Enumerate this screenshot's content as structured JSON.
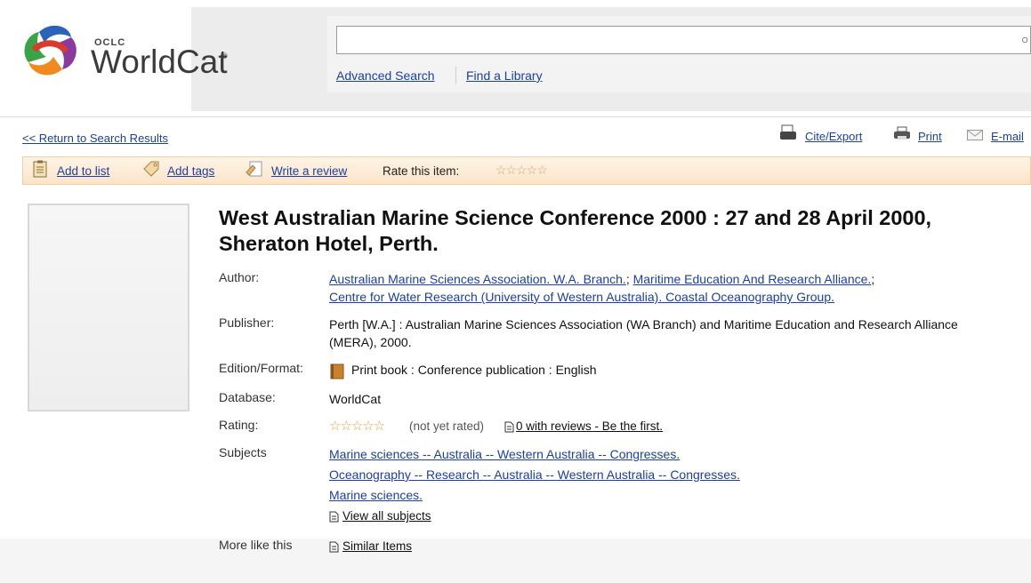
{
  "header": {
    "logo_small": "OCLC",
    "logo_word": "WorldCat",
    "logo_reg": "®",
    "search": {
      "value": "",
      "placeholder": ""
    },
    "advanced_search": "Advanced Search",
    "find_library": "Find a Library"
  },
  "nav": {
    "return": "<< Return to Search Results",
    "cite": "Cite/Export",
    "print": "Print",
    "email": "E-mail"
  },
  "actions": {
    "add_list": "Add to list",
    "add_tags": "Add tags",
    "write_review": "Write a review",
    "rate_label": "Rate this item:",
    "rate_stars": "☆☆☆☆☆"
  },
  "record": {
    "title": "West Australian Marine Science Conference 2000 : 27 and 28 April 2000, Sheraton Hotel, Perth.",
    "author_label": "Author:",
    "authors": [
      "Australian Marine Sciences Association. W.A. Branch.",
      "Maritime Education And Research Alliance.",
      "Centre for Water Research (University of Western Australia). Coastal Oceanography Group."
    ],
    "author_sep": "; ",
    "author_sep2": ";",
    "publisher_label": "Publisher:",
    "publisher": "Perth [W.A.] : Australian Marine Sciences Association (WA Branch) and Maritime Education and Research Alliance (MERA), 2000.",
    "edition_label": "Edition/Format:",
    "edition": "Print book : Conference publication : English",
    "database_label": "Database:",
    "database": "WorldCat",
    "rating_label": "Rating:",
    "rating_stars": "☆☆☆☆☆",
    "rating_value": 0,
    "rating_note": "(not yet rated)",
    "reviews_link": "0 with reviews - Be the first.",
    "subjects_label": "Subjects",
    "subjects": [
      "Marine sciences -- Australia -- Western Australia -- Congresses.",
      "Oceanography -- Research -- Australia -- Western Australia -- Congresses.",
      "Marine sciences."
    ],
    "view_all": "View all subjects",
    "more_label": "More like this",
    "similar": "Similar Items"
  },
  "colors": {
    "link": "#1a3fa6",
    "action_bar": "#fbe4c8",
    "star": "#e0a23a"
  }
}
